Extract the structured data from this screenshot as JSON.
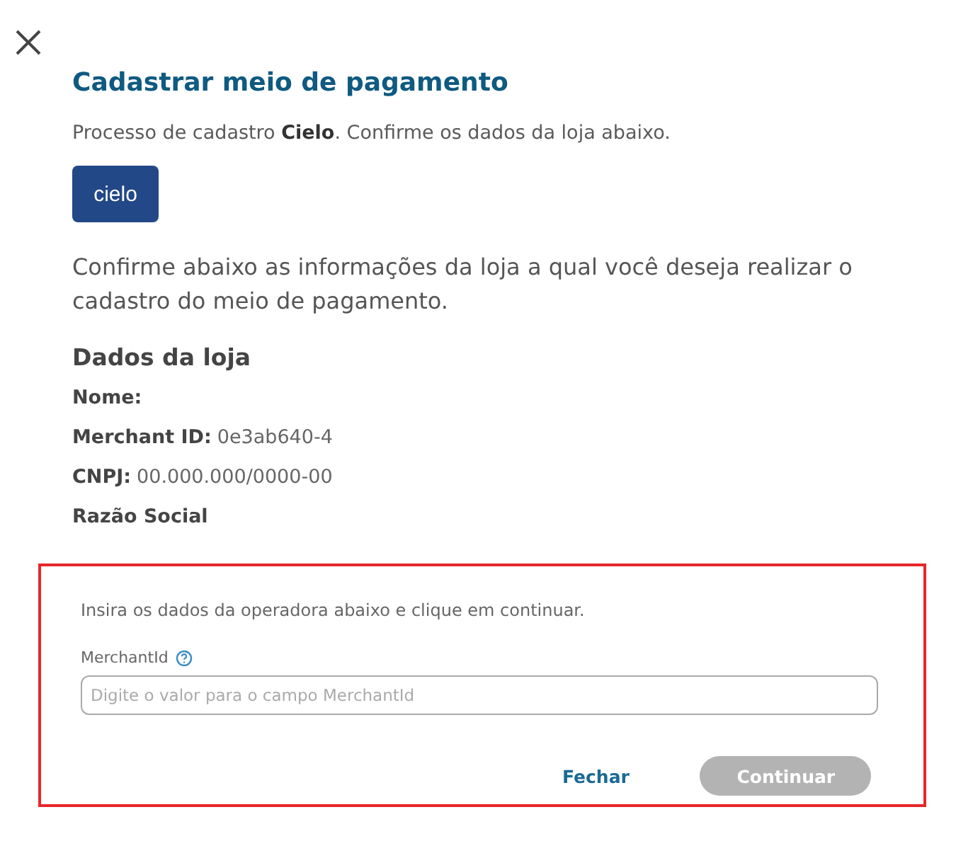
{
  "dialog": {
    "title": "Cadastrar meio de pagamento",
    "intro": "Processo de cadastro **Cielo**. Confirme os dados da loja abaixo.",
    "logo": "cielo",
    "description": "Confirme abaixo as informações da loja a qual você deseja realizar o cadastro do meio de pagamento.",
    "store_heading": "Dados da loja",
    "store_fields": [
      {
        "label": "Nome:"
      },
      {
        "label": "Merchant ID:",
        "value": "0e3ab640-4"
      },
      {
        "label": "CNPJ:",
        "value": "00.000.000/0000-00"
      },
      {
        "label": "Razão Social"
      }
    ]
  },
  "operator_form": {
    "instruction": "Insira os dados da operadora abaixo e clique em continuar.",
    "field_label": "MerchantId",
    "placeholder": "Digite o valor para o campo MerchantId",
    "buttons": [
      {
        "kind": "link",
        "label": "Fechar",
        "disabled": false
      },
      {
        "kind": "primary",
        "label": "Continuar",
        "disabled": true
      }
    ]
  }
}
